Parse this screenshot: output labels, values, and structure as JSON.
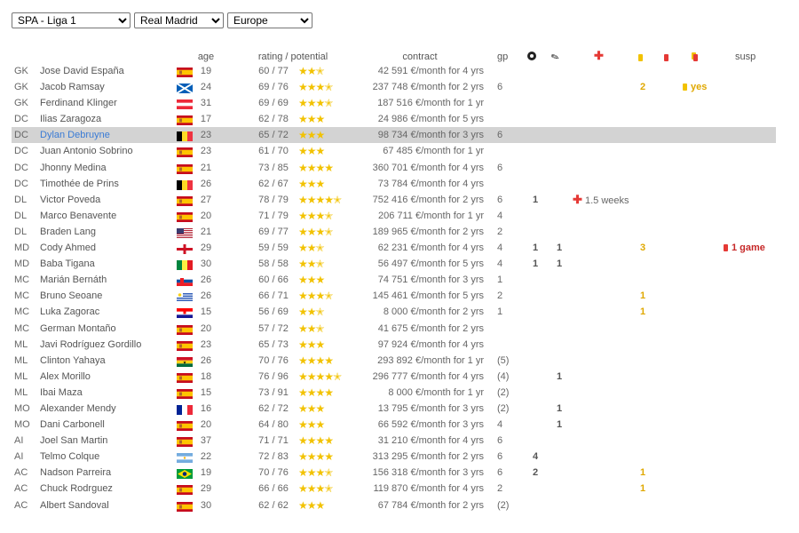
{
  "filters": {
    "league": "SPA - Liga 1",
    "team": "Real Madrid",
    "region": "Europe"
  },
  "headers": {
    "age": "age",
    "rating": "rating / potential",
    "contract": "contract",
    "gp": "gp",
    "susp": "susp"
  },
  "icons": {
    "goals": "soccer-ball-icon",
    "assists": "boot-icon",
    "injury": "red-cross-icon",
    "yellow": "yellow-card-icon",
    "red": "red-card-icon",
    "double_card": "yellow-red-card-icon"
  },
  "colors": {
    "star": "#f2c200",
    "selected_row": "#d3d3d3",
    "link": "#3a7bd5",
    "yellow": "#e0a800",
    "red": "#c62828"
  },
  "players": [
    {
      "pos": "GK",
      "name": "Jose David España",
      "flag": "spain",
      "age": "19",
      "rating": "60",
      "potential": "77",
      "stars": "★★✭",
      "contract": "42 591 €/month for 4 yrs",
      "gp": "",
      "goals": "",
      "assists": "",
      "injury": "",
      "yellow": "",
      "susp": ""
    },
    {
      "pos": "GK",
      "name": "Jacob Ramsay",
      "flag": "scotland",
      "age": "24",
      "rating": "69",
      "potential": "76",
      "stars": "★★★✭",
      "contract": "237 748 €/month for 2 yrs",
      "gp": "6",
      "goals": "",
      "assists": "",
      "injury": "",
      "yellow": "2",
      "susp_yellow": "yes",
      "susp": ""
    },
    {
      "pos": "GK",
      "name": "Ferdinand Klinger",
      "flag": "austria",
      "age": "31",
      "rating": "69",
      "potential": "69",
      "stars": "★★★✭",
      "contract": "187 516 €/month for 1 yr",
      "gp": "",
      "goals": "",
      "assists": "",
      "injury": "",
      "yellow": "",
      "susp": ""
    },
    {
      "pos": "DC",
      "name": "Ilias Zaragoza",
      "flag": "spain",
      "age": "17",
      "rating": "62",
      "potential": "78",
      "stars": "★★★",
      "contract": "24 986 €/month for 5 yrs",
      "gp": "",
      "goals": "",
      "assists": "",
      "injury": "",
      "yellow": "",
      "susp": ""
    },
    {
      "pos": "DC",
      "name": "Dylan Debruyne",
      "flag": "belgium",
      "age": "23",
      "rating": "65",
      "potential": "72",
      "stars": "★★★",
      "contract": "98 734 €/month for 3 yrs",
      "gp": "6",
      "goals": "",
      "assists": "",
      "injury": "",
      "yellow": "",
      "susp": "",
      "selected": true
    },
    {
      "pos": "DC",
      "name": "Juan Antonio Sobrino",
      "flag": "spain",
      "age": "23",
      "rating": "61",
      "potential": "70",
      "stars": "★★★",
      "contract": "67 485 €/month for 1 yr",
      "gp": "",
      "goals": "",
      "assists": "",
      "injury": "",
      "yellow": "",
      "susp": ""
    },
    {
      "pos": "DC",
      "name": "Jhonny Medina",
      "flag": "spain",
      "age": "21",
      "rating": "73",
      "potential": "85",
      "stars": "★★★★",
      "contract": "360 701 €/month for 4 yrs",
      "gp": "6",
      "goals": "",
      "assists": "",
      "injury": "",
      "yellow": "",
      "susp": ""
    },
    {
      "pos": "DC",
      "name": "Timothée de Prins",
      "flag": "belgium",
      "age": "26",
      "rating": "62",
      "potential": "67",
      "stars": "★★★",
      "contract": "73 784 €/month for 4 yrs",
      "gp": "",
      "goals": "",
      "assists": "",
      "injury": "",
      "yellow": "",
      "susp": ""
    },
    {
      "pos": "DL",
      "name": "Victor Poveda",
      "flag": "spain",
      "age": "27",
      "rating": "78",
      "potential": "79",
      "stars": "★★★★✭",
      "contract": "752 416 €/month for 2 yrs",
      "gp": "6",
      "goals": "1",
      "assists": "",
      "injury": "1.5 weeks",
      "yellow": "",
      "susp": ""
    },
    {
      "pos": "DL",
      "name": "Marco Benavente",
      "flag": "spain",
      "age": "20",
      "rating": "71",
      "potential": "79",
      "stars": "★★★✭",
      "contract": "206 711 €/month for 1 yr",
      "gp": "4",
      "goals": "",
      "assists": "",
      "injury": "",
      "yellow": "",
      "susp": ""
    },
    {
      "pos": "DL",
      "name": "Braden Lang",
      "flag": "usa",
      "age": "21",
      "rating": "69",
      "potential": "77",
      "stars": "★★★✭",
      "contract": "189 965 €/month for 2 yrs",
      "gp": "2",
      "goals": "",
      "assists": "",
      "injury": "",
      "yellow": "",
      "susp": ""
    },
    {
      "pos": "MD",
      "name": "Cody Ahmed",
      "flag": "england",
      "age": "29",
      "rating": "59",
      "potential": "59",
      "stars": "★★✭",
      "contract": "62 231 €/month for 4 yrs",
      "gp": "4",
      "goals": "1",
      "assists": "1",
      "injury": "",
      "yellow": "3",
      "susp": "1 game"
    },
    {
      "pos": "MD",
      "name": "Baba Tigana",
      "flag": "senegal",
      "age": "30",
      "rating": "58",
      "potential": "58",
      "stars": "★★✭",
      "contract": "56 497 €/month for 5 yrs",
      "gp": "4",
      "goals": "1",
      "assists": "1",
      "injury": "",
      "yellow": "",
      "susp": ""
    },
    {
      "pos": "MC",
      "name": "Marián Bernáth",
      "flag": "slovakia",
      "age": "26",
      "rating": "60",
      "potential": "66",
      "stars": "★★★",
      "contract": "74 751 €/month for 3 yrs",
      "gp": "1",
      "goals": "",
      "assists": "",
      "injury": "",
      "yellow": "",
      "susp": ""
    },
    {
      "pos": "MC",
      "name": "Bruno Seoane",
      "flag": "uruguay",
      "age": "26",
      "rating": "66",
      "potential": "71",
      "stars": "★★★✭",
      "contract": "145 461 €/month for 5 yrs",
      "gp": "2",
      "goals": "",
      "assists": "",
      "injury": "",
      "yellow": "1",
      "susp": ""
    },
    {
      "pos": "MC",
      "name": "Luka Zagorac",
      "flag": "croatia",
      "age": "15",
      "rating": "56",
      "potential": "69",
      "stars": "★★✭",
      "contract": "8 000 €/month for 2 yrs",
      "gp": "1",
      "goals": "",
      "assists": "",
      "injury": "",
      "yellow": "1",
      "susp": ""
    },
    {
      "pos": "MC",
      "name": "German Montaño",
      "flag": "spain",
      "age": "20",
      "rating": "57",
      "potential": "72",
      "stars": "★★✭",
      "contract": "41 675 €/month for 2 yrs",
      "gp": "",
      "goals": "",
      "assists": "",
      "injury": "",
      "yellow": "",
      "susp": ""
    },
    {
      "pos": "ML",
      "name": "Javi Rodríguez Gordillo",
      "flag": "spain",
      "age": "23",
      "rating": "65",
      "potential": "73",
      "stars": "★★★",
      "contract": "97 924 €/month for 4 yrs",
      "gp": "",
      "goals": "",
      "assists": "",
      "injury": "",
      "yellow": "",
      "susp": ""
    },
    {
      "pos": "ML",
      "name": "Clinton Yahaya",
      "flag": "ghana",
      "age": "26",
      "rating": "70",
      "potential": "76",
      "stars": "★★★★",
      "contract": "293 892 €/month for 1 yr",
      "gp": "(5)",
      "goals": "",
      "assists": "",
      "injury": "",
      "yellow": "",
      "susp": ""
    },
    {
      "pos": "ML",
      "name": "Alex Morillo",
      "flag": "spain",
      "age": "18",
      "rating": "76",
      "potential": "96",
      "stars": "★★★★✭",
      "contract": "296 777 €/month for 4 yrs",
      "gp": "(4)",
      "goals": "",
      "assists": "1",
      "injury": "",
      "yellow": "",
      "susp": ""
    },
    {
      "pos": "ML",
      "name": "Ibai Maza",
      "flag": "spain",
      "age": "15",
      "rating": "73",
      "potential": "91",
      "stars": "★★★★",
      "contract": "8 000 €/month for 1 yr",
      "gp": "(2)",
      "goals": "",
      "assists": "",
      "injury": "",
      "yellow": "",
      "susp": ""
    },
    {
      "pos": "MO",
      "name": "Alexander Mendy",
      "flag": "france",
      "age": "16",
      "rating": "62",
      "potential": "72",
      "stars": "★★★",
      "contract": "13 795 €/month for 3 yrs",
      "gp": "(2)",
      "goals": "",
      "assists": "1",
      "injury": "",
      "yellow": "",
      "susp": ""
    },
    {
      "pos": "MO",
      "name": "Dani Carbonell",
      "flag": "spain",
      "age": "20",
      "rating": "64",
      "potential": "80",
      "stars": "★★★",
      "contract": "66 592 €/month for 3 yrs",
      "gp": "4",
      "goals": "",
      "assists": "1",
      "injury": "",
      "yellow": "",
      "susp": ""
    },
    {
      "pos": "AI",
      "name": "Joel San Martin",
      "flag": "spain",
      "age": "37",
      "rating": "71",
      "potential": "71",
      "stars": "★★★★",
      "contract": "31 210 €/month for 4 yrs",
      "gp": "6",
      "goals": "",
      "assists": "",
      "injury": "",
      "yellow": "",
      "susp": ""
    },
    {
      "pos": "AI",
      "name": "Telmo Colque",
      "flag": "argentina",
      "age": "22",
      "rating": "72",
      "potential": "83",
      "stars": "★★★★",
      "contract": "313 295 €/month for 2 yrs",
      "gp": "6",
      "goals": "4",
      "assists": "",
      "injury": "",
      "yellow": "",
      "susp": ""
    },
    {
      "pos": "AC",
      "name": "Nadson Parreira",
      "flag": "brazil",
      "age": "19",
      "rating": "70",
      "potential": "76",
      "stars": "★★★✭",
      "contract": "156 318 €/month for 3 yrs",
      "gp": "6",
      "goals": "2",
      "assists": "",
      "injury": "",
      "yellow": "1",
      "susp": ""
    },
    {
      "pos": "AC",
      "name": "Chuck Rodrguez",
      "flag": "spain",
      "age": "29",
      "rating": "66",
      "potential": "66",
      "stars": "★★★✭",
      "contract": "119 870 €/month for 4 yrs",
      "gp": "2",
      "goals": "",
      "assists": "",
      "injury": "",
      "yellow": "1",
      "susp": ""
    },
    {
      "pos": "AC",
      "name": "Albert Sandoval",
      "flag": "spain",
      "age": "30",
      "rating": "62",
      "potential": "62",
      "stars": "★★★",
      "contract": "67 784 €/month for 2 yrs",
      "gp": "(2)",
      "goals": "",
      "assists": "",
      "injury": "",
      "yellow": "",
      "susp": ""
    }
  ]
}
